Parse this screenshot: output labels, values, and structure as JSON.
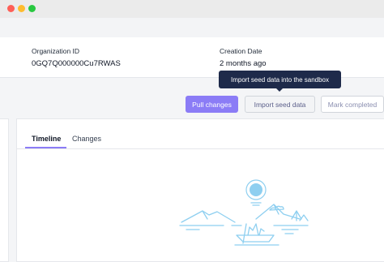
{
  "window": {
    "traffic_lights": [
      "close",
      "minimize",
      "maximize"
    ],
    "colors": {
      "close": "#fe5f57",
      "minimize": "#febc2e",
      "maximize": "#28c840"
    }
  },
  "details": {
    "organization_id_label": "Organization ID",
    "organization_id_value": "0GQ7Q000000Cu7RWAS",
    "creation_date_label": "Creation Date",
    "creation_date_value": "2 months ago"
  },
  "actions": {
    "pull_changes": "Pull changes",
    "import_seed_data": "Import seed data",
    "mark_completed": "Mark completed"
  },
  "tooltip": {
    "text": "Import seed data into the sandbox"
  },
  "tabs": [
    {
      "label": "Timeline",
      "active": true
    },
    {
      "label": "Changes",
      "active": false
    }
  ],
  "theme": {
    "accent": "#8b7cf6",
    "tooltip_bg": "#1e2a4a",
    "illustration": "#8ecff0"
  },
  "empty_state": {
    "icon": "landscape-boat-illustration"
  }
}
